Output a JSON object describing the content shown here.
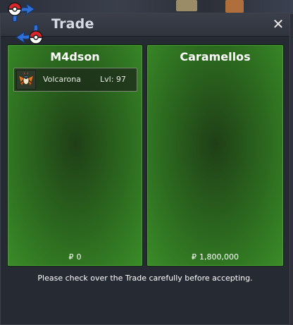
{
  "window": {
    "title": "Trade",
    "close_label": "✕"
  },
  "left_panel": {
    "player_name": "M4dson",
    "pokemon": [
      {
        "name": "Volcarona",
        "level": "Lvl: 97"
      }
    ],
    "currency_symbol": "₽",
    "money": "0"
  },
  "right_panel": {
    "player_name": "Caramellos",
    "pokemon": [],
    "currency_symbol": "₽",
    "money": "1,800,000"
  },
  "footer": {
    "notice": "Please check over the Trade carefully before accepting."
  }
}
